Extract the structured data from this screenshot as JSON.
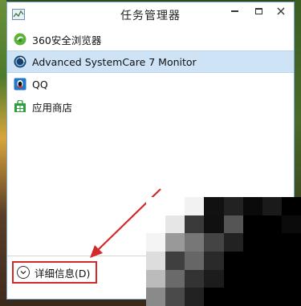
{
  "window": {
    "title": "任务管理器",
    "controls": [
      "minimize",
      "maximize",
      "close"
    ]
  },
  "apps": [
    {
      "name": "360安全浏览器",
      "icon": "browser-360-icon",
      "selected": false
    },
    {
      "name": "Advanced SystemCare 7 Monitor",
      "icon": "systemcare-icon",
      "selected": true
    },
    {
      "name": "QQ",
      "icon": "qq-icon",
      "selected": false
    },
    {
      "name": "应用商店",
      "icon": "store-icon",
      "selected": false
    }
  ],
  "footer": {
    "details_label": "详细信息(D)"
  },
  "colors": {
    "selection": "#cfe3f7",
    "highlight_box": "#d22a2a",
    "arrow": "#d22a2a"
  }
}
